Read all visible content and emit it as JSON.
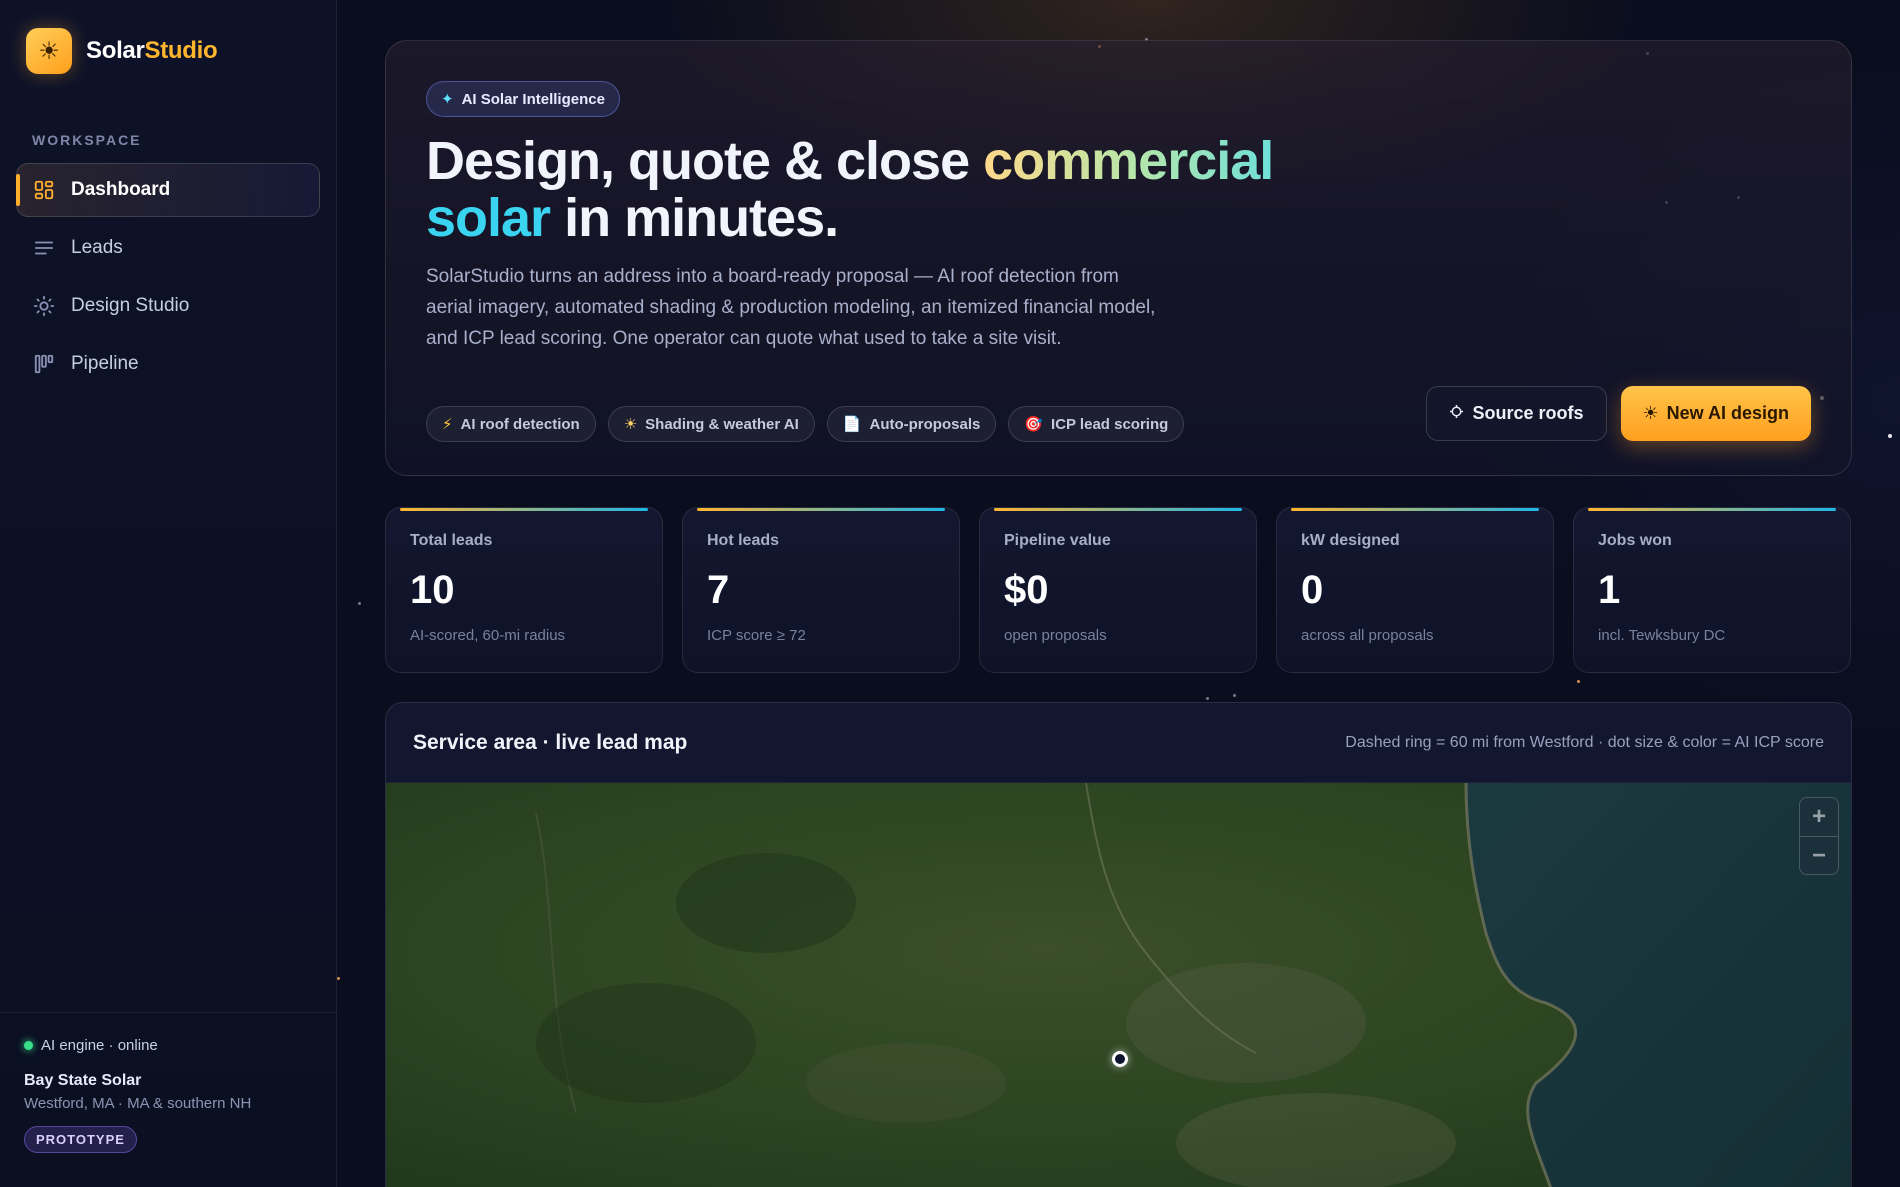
{
  "brand": {
    "name_primary": "Solar",
    "name_accent": "Studio",
    "logo_icon": "sun-icon"
  },
  "sidebar": {
    "section_label": "WORKSPACE",
    "items": [
      {
        "label": "Dashboard",
        "icon": "grid-icon",
        "active": true
      },
      {
        "label": "Leads",
        "icon": "list-icon",
        "active": false
      },
      {
        "label": "Design Studio",
        "icon": "sun-icon",
        "active": false
      },
      {
        "label": "Pipeline",
        "icon": "kanban-icon",
        "active": false
      }
    ],
    "footer": {
      "status": "AI engine · online",
      "org_name": "Bay State Solar",
      "org_location": "Westford, MA · MA & southern NH",
      "badge": "PROTOTYPE"
    }
  },
  "hero": {
    "pill": "AI Solar Intelligence",
    "title_part1": "Design, quote & close ",
    "title_highlight": "commercial",
    "title_cyan": "solar",
    "title_part2": " in minutes.",
    "description": "SolarStudio turns an address into a board-ready proposal — AI roof detection from aerial imagery, automated shading & production modeling, an itemized financial model, and ICP lead scoring. One operator can quote what used to take a site visit.",
    "chips": [
      {
        "icon": "⚡",
        "label": "AI roof detection"
      },
      {
        "icon": "☀",
        "label": "Shading & weather AI"
      },
      {
        "icon": "📄",
        "label": "Auto-proposals"
      },
      {
        "icon": "🎯",
        "label": "ICP lead scoring"
      }
    ],
    "source_button": "Source roofs",
    "primary_button": "New AI design"
  },
  "stats": [
    {
      "label": "Total leads",
      "value": "10",
      "sub": "AI-scored, 60-mi radius"
    },
    {
      "label": "Hot leads",
      "value": "7",
      "sub": "ICP score ≥ 72"
    },
    {
      "label": "Pipeline value",
      "value": "$0",
      "sub": "open proposals"
    },
    {
      "label": "kW designed",
      "value": "0",
      "sub": "across all proposals"
    },
    {
      "label": "Jobs won",
      "value": "1",
      "sub": "incl. Tewksbury DC"
    }
  ],
  "map": {
    "title": "Service area · live lead map",
    "legend": "Dashed ring = 60 mi from Westford · dot size & color = AI ICP score",
    "zoom_in": "+",
    "zoom_out": "−"
  }
}
